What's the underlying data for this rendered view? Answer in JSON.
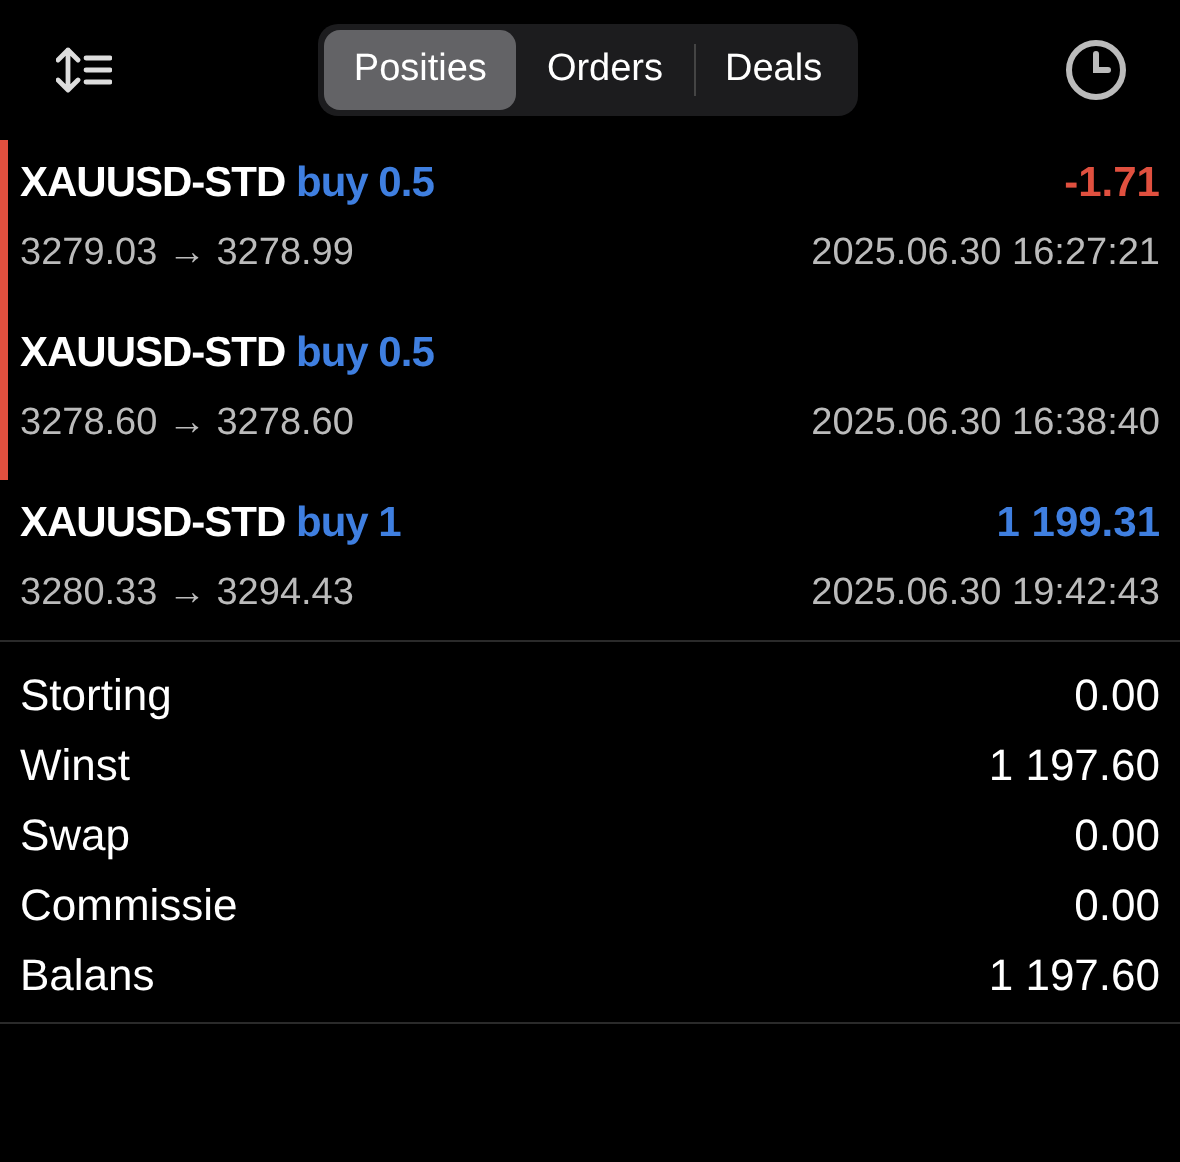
{
  "tabs": [
    {
      "label": "Posities",
      "selected": true
    },
    {
      "label": "Orders",
      "selected": false
    },
    {
      "label": "Deals",
      "selected": false
    }
  ],
  "positions": [
    {
      "symbol": "XAUUSD-STD",
      "side": "buy 0.5",
      "profit": "-1.71",
      "color": "#e0503f",
      "prices": "3279.03 → 3278.99",
      "time": "2025.06.30 16:27:21",
      "marked": true
    },
    {
      "symbol": "XAUUSD-STD",
      "side": "buy 0.5",
      "prices": "3278.60 → 3278.60",
      "time": "2025.06.30 16:38:40",
      "marked": true
    },
    {
      "symbol": "XAUUSD-STD",
      "side": "buy 1",
      "profit": "1 199.31",
      "color": "#3f7fe0",
      "prices": "3280.33 → 3294.43",
      "time": "2025.06.30 19:42:43",
      "marked": false
    }
  ],
  "summary": [
    {
      "label": "Storting",
      "value": "0.00"
    },
    {
      "label": "Winst",
      "value": "1 197.60"
    },
    {
      "label": "Swap",
      "value": "0.00"
    },
    {
      "label": "Commissie",
      "value": "0.00"
    },
    {
      "label": "Balans",
      "value": "1 197.60"
    }
  ]
}
